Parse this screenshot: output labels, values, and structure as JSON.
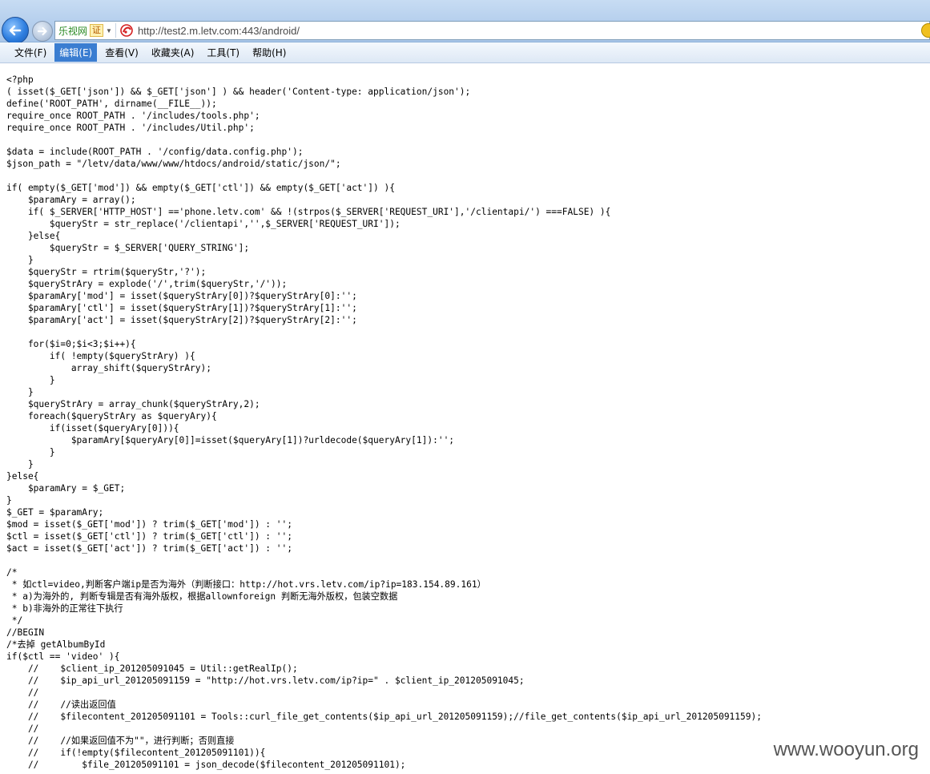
{
  "browser": {
    "brand": "乐视网",
    "cert_badge": "证",
    "url": "http://test2.m.letv.com:443/android/",
    "back_icon": "back-arrow-icon",
    "forward_icon": "forward-arrow-icon",
    "accent": "#3a7dd1"
  },
  "menu": {
    "items": [
      {
        "label": "文件(F)"
      },
      {
        "label": "编辑(E)"
      },
      {
        "label": "查看(V)"
      },
      {
        "label": "收藏夹(A)"
      },
      {
        "label": "工具(T)"
      },
      {
        "label": "帮助(H)"
      }
    ],
    "active_index": 1
  },
  "code": {
    "lines": [
      "<?php",
      "( isset($_GET['json']) && $_GET['json'] ) && header('Content-type: application/json');",
      "define('ROOT_PATH', dirname(__FILE__));",
      "require_once ROOT_PATH . '/includes/tools.php';",
      "require_once ROOT_PATH . '/includes/Util.php';",
      "",
      "$data = include(ROOT_PATH . '/config/data.config.php');",
      "$json_path = \"/letv/data/www/www/htdocs/android/static/json/\";",
      "",
      "if( empty($_GET['mod']) && empty($_GET['ctl']) && empty($_GET['act']) ){",
      "    $paramAry = array();",
      "    if( $_SERVER['HTTP_HOST'] =='phone.letv.com' && !(strpos($_SERVER['REQUEST_URI'],'/clientapi/') ===FALSE) ){",
      "        $queryStr = str_replace('/clientapi','',$_SERVER['REQUEST_URI']);",
      "    }else{",
      "        $queryStr = $_SERVER['QUERY_STRING'];",
      "    }",
      "    $queryStr = rtrim($queryStr,'?');",
      "    $queryStrAry = explode('/',trim($queryStr,'/'));",
      "    $paramAry['mod'] = isset($queryStrAry[0])?$queryStrAry[0]:'';",
      "    $paramAry['ctl'] = isset($queryStrAry[1])?$queryStrAry[1]:'';",
      "    $paramAry['act'] = isset($queryStrAry[2])?$queryStrAry[2]:'';",
      "",
      "    for($i=0;$i<3;$i++){",
      "        if( !empty($queryStrAry) ){",
      "            array_shift($queryStrAry);",
      "        }",
      "    }",
      "    $queryStrAry = array_chunk($queryStrAry,2);",
      "    foreach($queryStrAry as $queryAry){",
      "        if(isset($queryAry[0])){",
      "            $paramAry[$queryAry[0]]=isset($queryAry[1])?urldecode($queryAry[1]):'';",
      "        }",
      "    }",
      "}else{",
      "    $paramAry = $_GET;",
      "}",
      "$_GET = $paramAry;",
      "$mod = isset($_GET['mod']) ? trim($_GET['mod']) : '';",
      "$ctl = isset($_GET['ctl']) ? trim($_GET['ctl']) : '';",
      "$act = isset($_GET['act']) ? trim($_GET['act']) : '';",
      "",
      "/*",
      " * 如ctl=video,判断客户端ip是否为海外（判断接口：http://hot.vrs.letv.com/ip?ip=183.154.89.161）",
      " * a)为海外的, 判断专辑是否有海外版权，根据allownforeign 判断无海外版权，包装空数据",
      " * b)非海外的正常往下执行",
      " */",
      "//BEGIN",
      "/*去掉 getAlbumById",
      "if($ctl == 'video' ){",
      "    //    $client_ip_201205091045 = Util::getRealIp();",
      "    //    $ip_api_url_201205091159 = \"http://hot.vrs.letv.com/ip?ip=\" . $client_ip_201205091045;",
      "    //",
      "    //    //读出返回值",
      "    //    $filecontent_201205091101 = Tools::curl_file_get_contents($ip_api_url_201205091159);//file_get_contents($ip_api_url_201205091159);",
      "    //",
      "    //    //如果返回值不为\"\"，进行判断；否则直接",
      "    //    if(!empty($filecontent_201205091101)){",
      "    //        $file_201205091101 = json_decode($filecontent_201205091101);"
    ]
  },
  "watermark": "www.wooyun.org"
}
